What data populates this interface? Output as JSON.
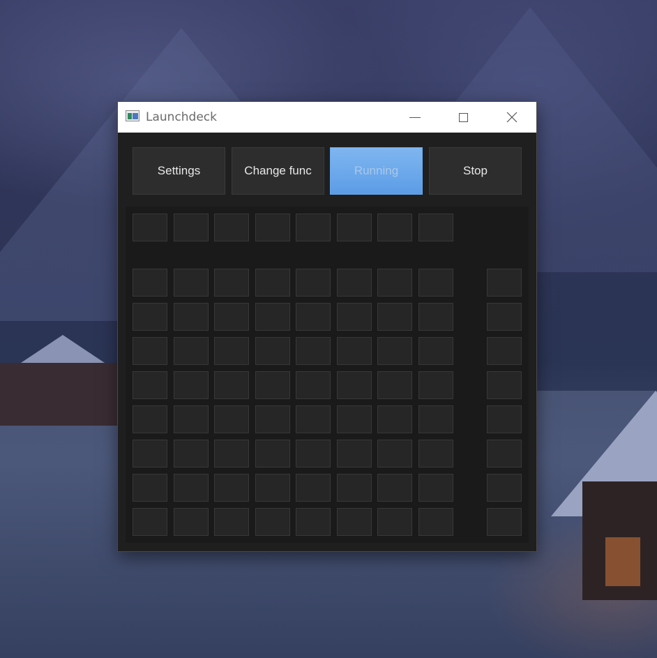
{
  "window": {
    "title": "Launchdeck",
    "icon": "app-window-icon",
    "controls": [
      "minimize-icon",
      "maximize-icon",
      "close-icon"
    ]
  },
  "toolbar": {
    "settings_label": "Settings",
    "change_func_label": "Change func",
    "running_label": "Running",
    "stop_label": "Stop"
  },
  "colors": {
    "active_button": "#6aa8ee",
    "pad": "#262626",
    "window_bg": "#1f1f1f"
  },
  "pads": {
    "top_row_count": 8,
    "grid_rows": 8,
    "grid_columns": 8,
    "side_column_count": 8
  }
}
